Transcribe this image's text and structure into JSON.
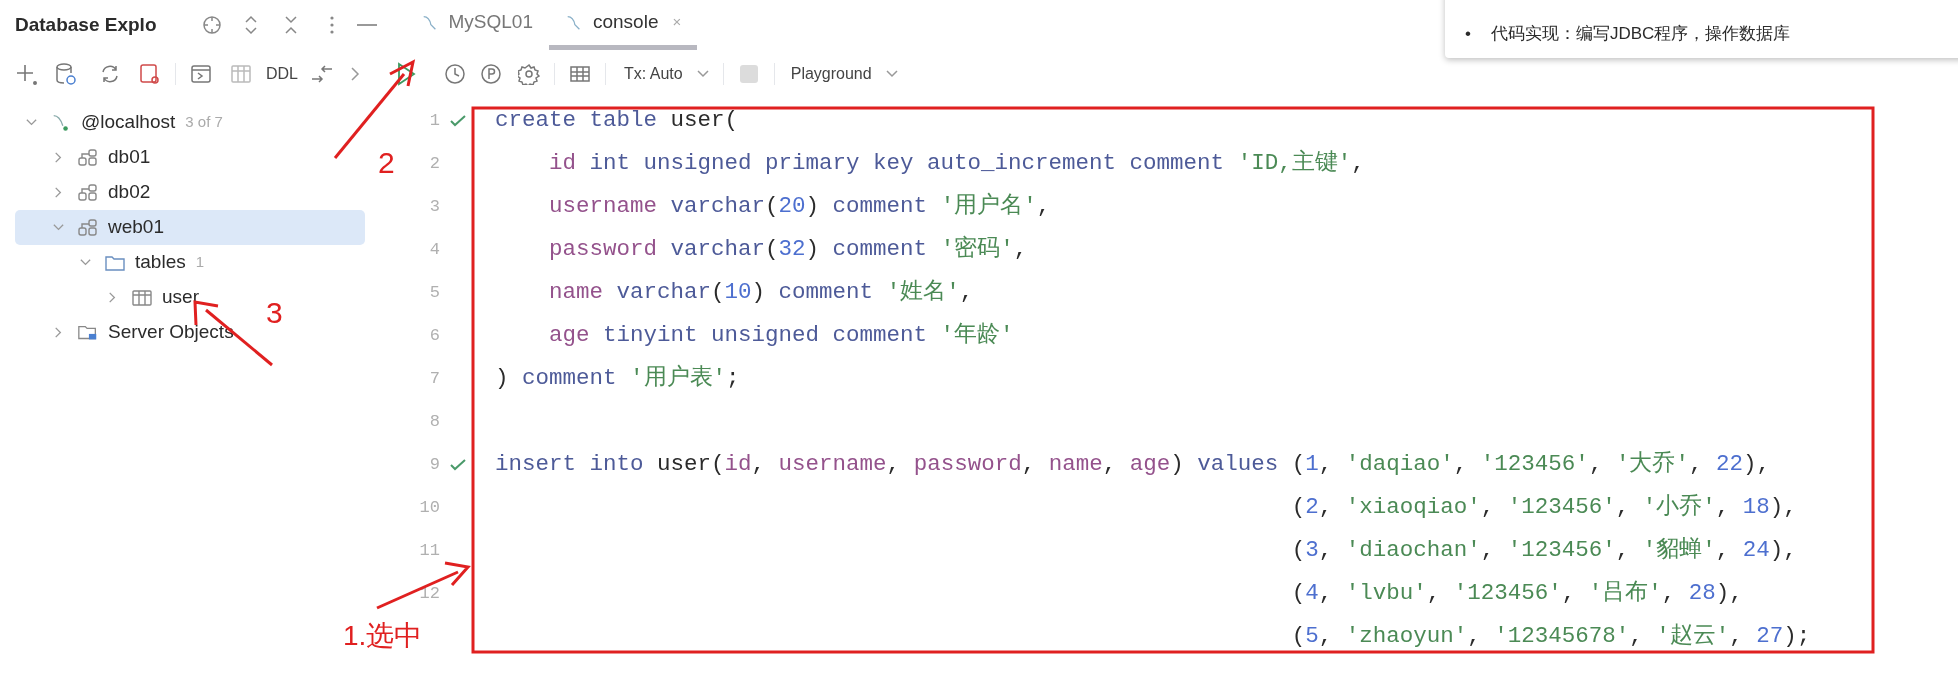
{
  "window": {
    "title": "Database Explo"
  },
  "tabs": [
    {
      "label": "MySQL01",
      "selected": false
    },
    {
      "label": "console",
      "selected": true,
      "close": "×"
    }
  ],
  "toolbar": {
    "ddl": "DDL",
    "tx": "Tx: Auto",
    "checked": false,
    "mode": "Playground"
  },
  "tree": [
    {
      "label": "@localhost",
      "kind": "connection",
      "count": "3 of 7",
      "expanded": true,
      "selected": false,
      "children": [
        {
          "label": "db01",
          "kind": "schema",
          "expanded": false,
          "selected": false
        },
        {
          "label": "db02",
          "kind": "schema",
          "expanded": false,
          "selected": false
        },
        {
          "label": "web01",
          "kind": "schema",
          "expanded": true,
          "selected": true,
          "children": [
            {
              "label": "tables",
              "kind": "folder",
              "count": "1",
              "expanded": true,
              "selected": false,
              "children": [
                {
                  "label": "user",
                  "kind": "table",
                  "expanded": false,
                  "selected": false
                }
              ]
            }
          ]
        },
        {
          "label": "Server Objects",
          "kind": "server",
          "expanded": false,
          "selected": false
        }
      ]
    }
  ],
  "notes": {
    "bullet": "•",
    "text": "代码实现：编写JDBC程序，操作数据库"
  },
  "editor": {
    "lines": [
      {
        "number": "1",
        "executed": true,
        "kind": "plain",
        "tokens": [
          {
            "text": "create table ",
            "kind": "keyword"
          },
          {
            "text": "user(",
            "kind": "plain"
          }
        ]
      },
      {
        "number": "2",
        "executed": false,
        "kind": "indent",
        "tokens": [
          {
            "text": "id",
            "kind": "field"
          },
          {
            "text": " int unsigned primary key auto_increment comment ",
            "kind": "keyword"
          },
          {
            "text": "'ID,主键'",
            "kind": "string"
          },
          {
            "text": ",",
            "kind": "plain"
          }
        ]
      },
      {
        "number": "3",
        "executed": false,
        "kind": "indent",
        "tokens": [
          {
            "text": "username",
            "kind": "field"
          },
          {
            "text": " varchar",
            "kind": "keyword"
          },
          {
            "text": "(",
            "kind": "plain"
          },
          {
            "text": "20",
            "kind": "number"
          },
          {
            "text": ") ",
            "kind": "plain"
          },
          {
            "text": "comment ",
            "kind": "keyword"
          },
          {
            "text": "'用户名'",
            "kind": "string"
          },
          {
            "text": ",",
            "kind": "plain"
          }
        ]
      },
      {
        "number": "4",
        "executed": false,
        "kind": "indent",
        "tokens": [
          {
            "text": "password",
            "kind": "field"
          },
          {
            "text": " varchar",
            "kind": "keyword"
          },
          {
            "text": "(",
            "kind": "plain"
          },
          {
            "text": "32",
            "kind": "number"
          },
          {
            "text": ") ",
            "kind": "plain"
          },
          {
            "text": "comment ",
            "kind": "keyword"
          },
          {
            "text": "'密码'",
            "kind": "string"
          },
          {
            "text": ",",
            "kind": "plain"
          }
        ]
      },
      {
        "number": "5",
        "executed": false,
        "kind": "indent",
        "tokens": [
          {
            "text": "name",
            "kind": "field"
          },
          {
            "text": " varchar",
            "kind": "keyword"
          },
          {
            "text": "(",
            "kind": "plain"
          },
          {
            "text": "10",
            "kind": "number"
          },
          {
            "text": ") ",
            "kind": "plain"
          },
          {
            "text": "comment ",
            "kind": "keyword"
          },
          {
            "text": "'姓名'",
            "kind": "string"
          },
          {
            "text": ",",
            "kind": "plain"
          }
        ]
      },
      {
        "number": "6",
        "executed": false,
        "kind": "indent",
        "tokens": [
          {
            "text": "age",
            "kind": "field"
          },
          {
            "text": " tinyint unsigned comment ",
            "kind": "keyword"
          },
          {
            "text": "'年龄'",
            "kind": "string"
          }
        ]
      },
      {
        "number": "7",
        "executed": false,
        "kind": "plain",
        "tokens": [
          {
            "text": ") ",
            "kind": "plain"
          },
          {
            "text": "comment ",
            "kind": "keyword"
          },
          {
            "text": "'用户表'",
            "kind": "string"
          },
          {
            "text": ";",
            "kind": "plain"
          }
        ]
      },
      {
        "number": "8",
        "executed": false
      },
      {
        "number": "9",
        "executed": true,
        "kind": "plain",
        "tokens": [
          {
            "text": "insert into ",
            "kind": "keyword"
          },
          {
            "text": "user(",
            "kind": "plain"
          },
          {
            "text": "id",
            "kind": "field"
          },
          {
            "text": ", ",
            "kind": "plain"
          },
          {
            "text": "username",
            "kind": "field"
          },
          {
            "text": ", ",
            "kind": "plain"
          },
          {
            "text": "password",
            "kind": "field"
          },
          {
            "text": ", ",
            "kind": "plain"
          },
          {
            "text": "name",
            "kind": "field"
          },
          {
            "text": ", ",
            "kind": "plain"
          },
          {
            "text": "age",
            "kind": "field"
          },
          {
            "text": ") ",
            "kind": "plain"
          },
          {
            "text": "values ",
            "kind": "keyword"
          },
          {
            "text": "(",
            "kind": "plain"
          },
          {
            "text": "1",
            "kind": "number"
          },
          {
            "text": ", ",
            "kind": "plain"
          },
          {
            "text": "'daqiao'",
            "kind": "string"
          },
          {
            "text": ", ",
            "kind": "plain"
          },
          {
            "text": "'123456'",
            "kind": "string"
          },
          {
            "text": ", ",
            "kind": "plain"
          },
          {
            "text": "'大乔'",
            "kind": "string"
          },
          {
            "text": ", ",
            "kind": "plain"
          },
          {
            "text": "22",
            "kind": "number"
          },
          {
            "text": "),",
            "kind": "plain"
          }
        ]
      },
      {
        "number": "10",
        "executed": false,
        "kind": "continuation",
        "tokens": [
          {
            "text": "(",
            "kind": "plain"
          },
          {
            "text": "2",
            "kind": "number"
          },
          {
            "text": ", ",
            "kind": "plain"
          },
          {
            "text": "'xiaoqiao'",
            "kind": "string"
          },
          {
            "text": ", ",
            "kind": "plain"
          },
          {
            "text": "'123456'",
            "kind": "string"
          },
          {
            "text": ", ",
            "kind": "plain"
          },
          {
            "text": "'小乔'",
            "kind": "string"
          },
          {
            "text": ", ",
            "kind": "plain"
          },
          {
            "text": "18",
            "kind": "number"
          },
          {
            "text": "),",
            "kind": "plain"
          }
        ]
      },
      {
        "number": "11",
        "executed": false,
        "kind": "continuation",
        "tokens": [
          {
            "text": "(",
            "kind": "plain"
          },
          {
            "text": "3",
            "kind": "number"
          },
          {
            "text": ", ",
            "kind": "plain"
          },
          {
            "text": "'diaochan'",
            "kind": "string"
          },
          {
            "text": ", ",
            "kind": "plain"
          },
          {
            "text": "'123456'",
            "kind": "string"
          },
          {
            "text": ", ",
            "kind": "plain"
          },
          {
            "text": "'貂蝉'",
            "kind": "string"
          },
          {
            "text": ", ",
            "kind": "plain"
          },
          {
            "text": "24",
            "kind": "number"
          },
          {
            "text": "),",
            "kind": "plain"
          }
        ]
      },
      {
        "number": "12",
        "executed": false,
        "kind": "continuation",
        "tokens": [
          {
            "text": "(",
            "kind": "plain"
          },
          {
            "text": "4",
            "kind": "number"
          },
          {
            "text": ", ",
            "kind": "plain"
          },
          {
            "text": "'lvbu'",
            "kind": "string"
          },
          {
            "text": ", ",
            "kind": "plain"
          },
          {
            "text": "'123456'",
            "kind": "string"
          },
          {
            "text": ", ",
            "kind": "plain"
          },
          {
            "text": "'吕布'",
            "kind": "string"
          },
          {
            "text": ", ",
            "kind": "plain"
          },
          {
            "text": "28",
            "kind": "number"
          },
          {
            "text": "),",
            "kind": "plain"
          }
        ]
      },
      {
        "executed": false,
        "kind": "continuation",
        "tokens": [
          {
            "text": "(",
            "kind": "plain"
          },
          {
            "text": "5",
            "kind": "number"
          },
          {
            "text": ", ",
            "kind": "plain"
          },
          {
            "text": "'zhaoyun'",
            "kind": "string"
          },
          {
            "text": ", ",
            "kind": "plain"
          },
          {
            "text": "'12345678'",
            "kind": "string"
          },
          {
            "text": ", ",
            "kind": "plain"
          },
          {
            "text": "'赵云'",
            "kind": "string"
          },
          {
            "text": ", ",
            "kind": "plain"
          },
          {
            "text": "27",
            "kind": "number"
          },
          {
            "text": ");",
            "kind": "plain"
          }
        ]
      }
    ]
  },
  "annotations": [
    {
      "kind": "step2",
      "text": "2"
    },
    {
      "kind": "step3",
      "text": "3"
    },
    {
      "kind": "step1",
      "text": "1.选中"
    }
  ]
}
